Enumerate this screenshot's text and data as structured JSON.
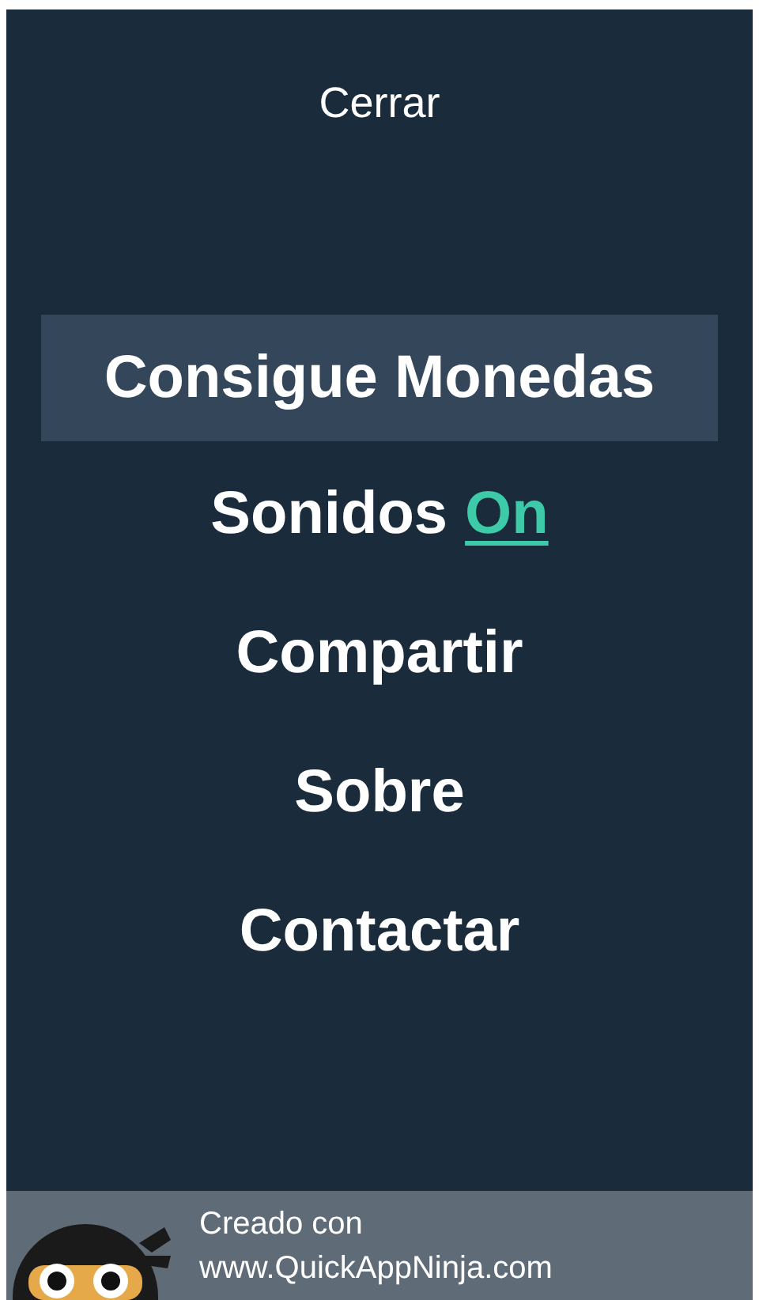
{
  "close_button": {
    "label": "Cerrar"
  },
  "menu": [
    {
      "kind": "link",
      "label": "Consigue Monedas",
      "selected": true
    },
    {
      "kind": "toggle",
      "label": "Sonidos",
      "value": "On",
      "selected": false
    },
    {
      "kind": "link",
      "label": "Compartir",
      "selected": false
    },
    {
      "kind": "link",
      "label": "Sobre",
      "selected": false
    },
    {
      "kind": "link",
      "label": "Contactar",
      "selected": false
    }
  ],
  "footer": {
    "lines": [
      "Creado con",
      "www.QuickAppNinja.com"
    ]
  }
}
